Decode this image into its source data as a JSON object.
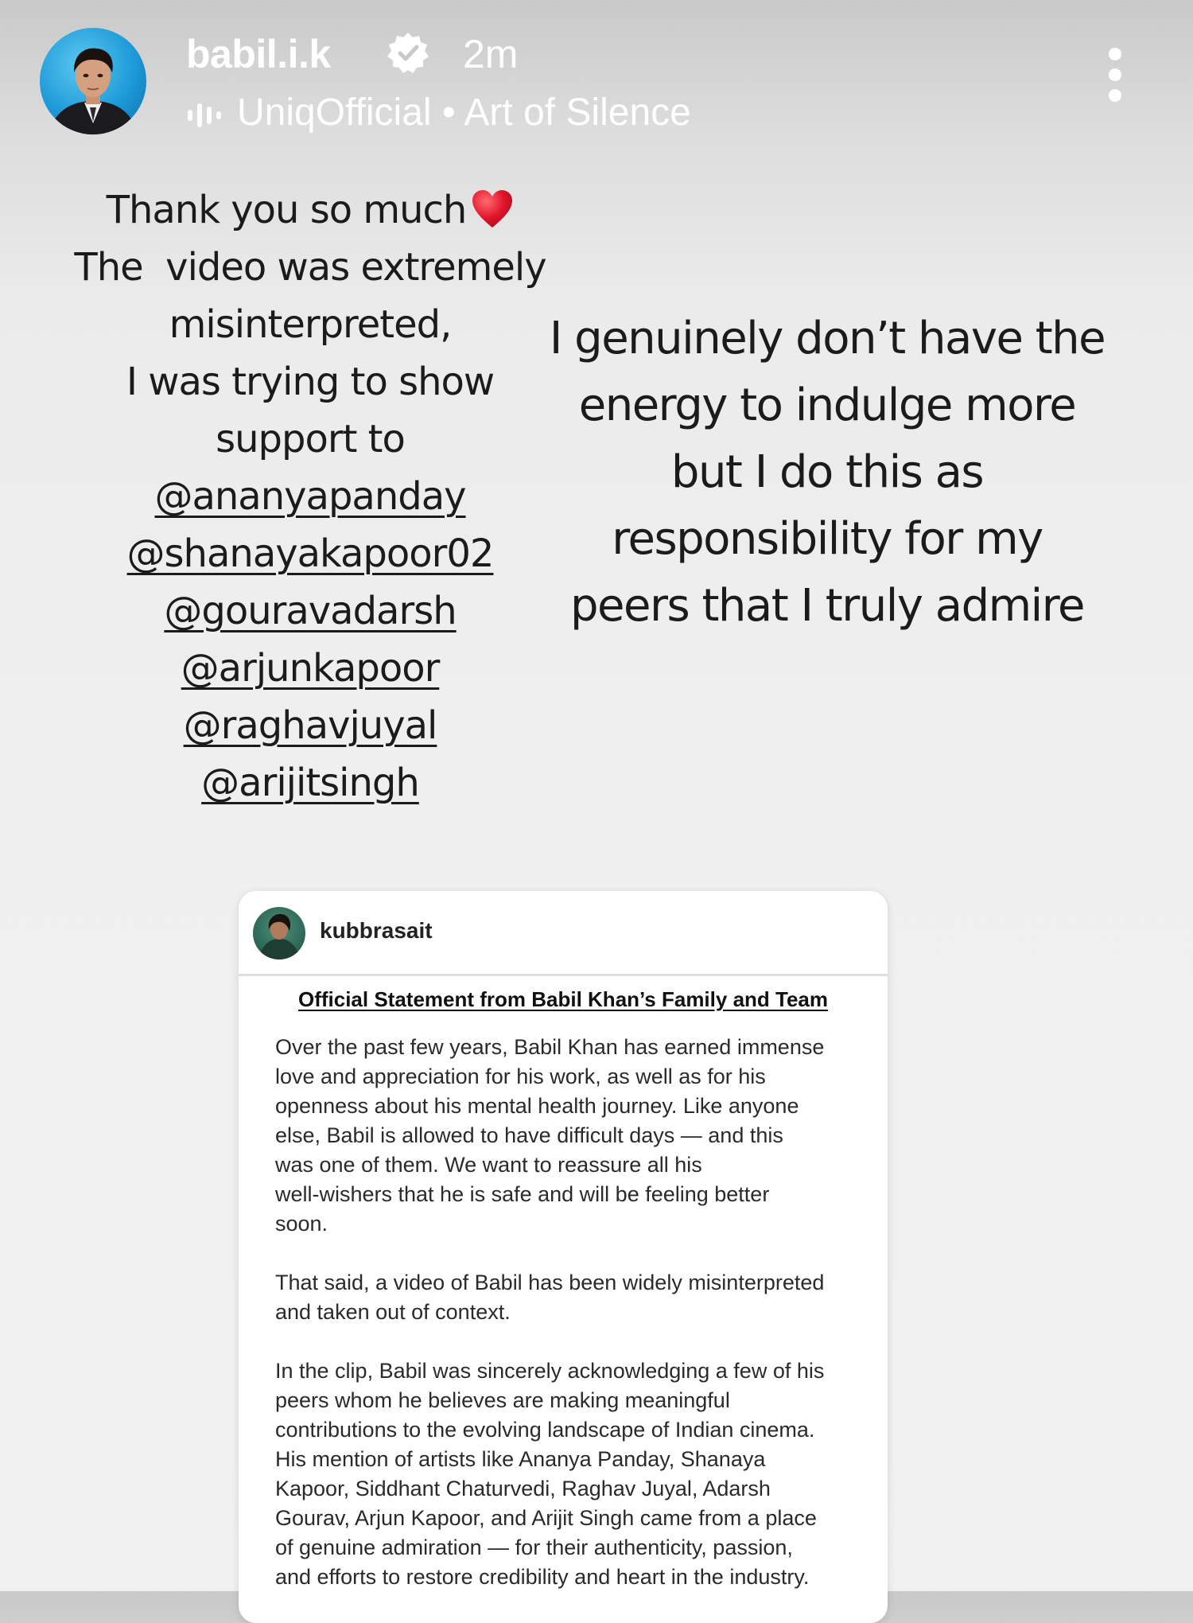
{
  "header": {
    "username": "babil.i.k",
    "time_ago": "2m",
    "music_label": "UniqOfficial • Art of Silence",
    "icons": [
      "avatar",
      "verified-badge-icon",
      "music-bars-icon",
      "more-options-icon"
    ]
  },
  "left_text": {
    "lines": [
      "Thank you so much",
      "The  video was extremely",
      "misinterpreted,",
      "I was trying to show",
      "support to"
    ],
    "mentions": [
      "@ananyapanday",
      "@shanayakapoor02",
      "@gouravadarsh",
      "@arjunkapoor",
      "@raghavjuyal",
      "@arijitsingh"
    ]
  },
  "right_text": {
    "lines": [
      "I genuinely don’t have the",
      "energy to indulge more",
      "but I do this as",
      "responsibility for my",
      "peers that I truly admire"
    ]
  },
  "card": {
    "username": "kubbrasait",
    "title": "Official Statement from Babil Khan’s Family and Team",
    "paragraphs": [
      [
        "Over the past few years, Babil Khan has earned immense",
        "love and appreciation for his work, as well as for his",
        "openness about his mental health journey. Like anyone",
        "else, Babil is allowed to have difficult days — and this",
        "was one of them. We want to reassure all his",
        "well-wishers that he is safe and will be feeling better",
        "soon."
      ],
      [
        "That said, a video of Babil has been widely misinterpreted",
        "and taken out of context."
      ],
      [
        "In the clip, Babil was sincerely acknowledging a few of his",
        "peers whom he believes are making meaningful",
        "contributions to the evolving landscape of Indian cinema.",
        "His mention of artists like Ananya Panday, Shanaya",
        "Kapoor, Siddhant Chaturvedi, Raghav Juyal, Adarsh",
        "Gourav, Arjun Kapoor, and Arijit Singh came from a place",
        "of genuine admiration — for their authenticity, passion,",
        "and efforts to restore credibility and heart in the industry."
      ]
    ]
  },
  "colors": {
    "header_text": "#ffffff",
    "body_text": "#1b1b1b",
    "heart": "#e0152a",
    "card_bg": "#ffffff"
  }
}
